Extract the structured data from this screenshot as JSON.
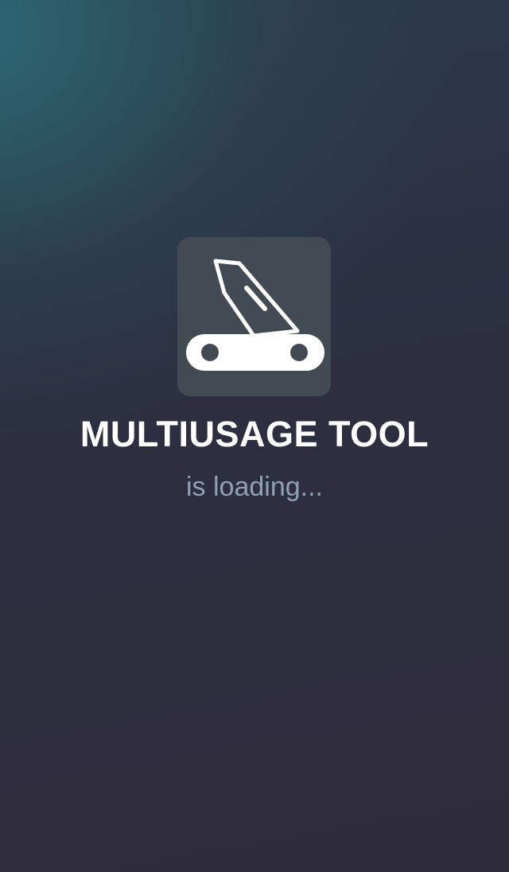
{
  "app": {
    "title": "MULTIUSAGE TOOL",
    "status": "is loading...",
    "icon": "pocket-knife-icon"
  },
  "colors": {
    "background_top": "#2c6c78",
    "background_main": "#2d2f40",
    "icon_tile": "#424a54",
    "title": "#ffffff",
    "status": "#8fa3b3"
  }
}
